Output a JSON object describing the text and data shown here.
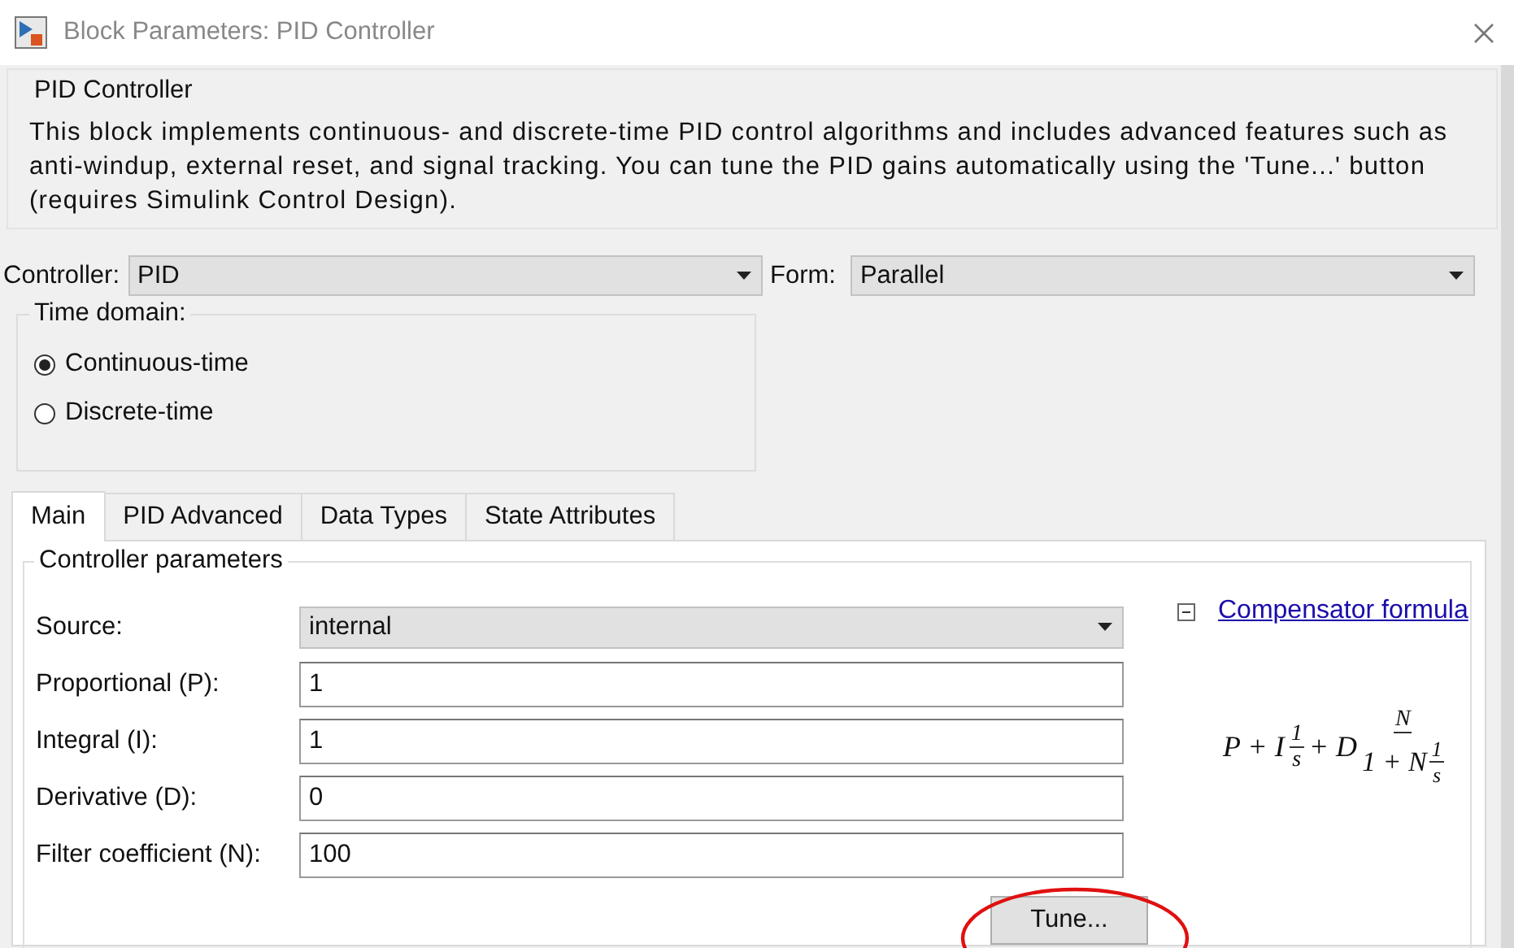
{
  "window": {
    "title": "Block Parameters: PID Controller"
  },
  "description": {
    "title": "PID Controller",
    "text": "This block implements continuous- and discrete-time PID control algorithms and includes advanced features such as anti-windup, external reset, and signal tracking. You can tune the PID gains automatically using the 'Tune...' button (requires Simulink Control Design)."
  },
  "controller": {
    "label": "Controller:",
    "value": "PID"
  },
  "form": {
    "label": "Form:",
    "value": "Parallel"
  },
  "time_domain": {
    "title": "Time domain:",
    "options": [
      {
        "label": "Continuous-time",
        "selected": true
      },
      {
        "label": "Discrete-time",
        "selected": false
      }
    ]
  },
  "tabs": [
    {
      "label": "Main",
      "selected": true
    },
    {
      "label": "PID Advanced",
      "selected": false
    },
    {
      "label": "Data Types",
      "selected": false
    },
    {
      "label": "State Attributes",
      "selected": false
    }
  ],
  "controller_parameters": {
    "title": "Controller parameters",
    "fields": [
      {
        "kind": "dropdown",
        "label": "Source:",
        "value": "internal"
      },
      {
        "kind": "text",
        "label": "Proportional (P):",
        "value": "1"
      },
      {
        "kind": "text",
        "label": "Integral (I):",
        "value": "1"
      },
      {
        "kind": "text",
        "label": "Derivative (D):",
        "value": "0"
      },
      {
        "kind": "text",
        "label": "Filter coefficient (N):",
        "value": "100"
      }
    ]
  },
  "compensator": {
    "link": "Compensator formula",
    "expanded": true,
    "formula": {
      "lead": "P + I",
      "frac1_num": "1",
      "frac1_den": "s",
      "mid": "+ D",
      "frac2_num": "N",
      "frac2_den_lead": "1 + N",
      "frac3_num": "1",
      "frac3_den": "s"
    }
  },
  "tune_button": {
    "label": "Tune...",
    "highlighted": true
  }
}
